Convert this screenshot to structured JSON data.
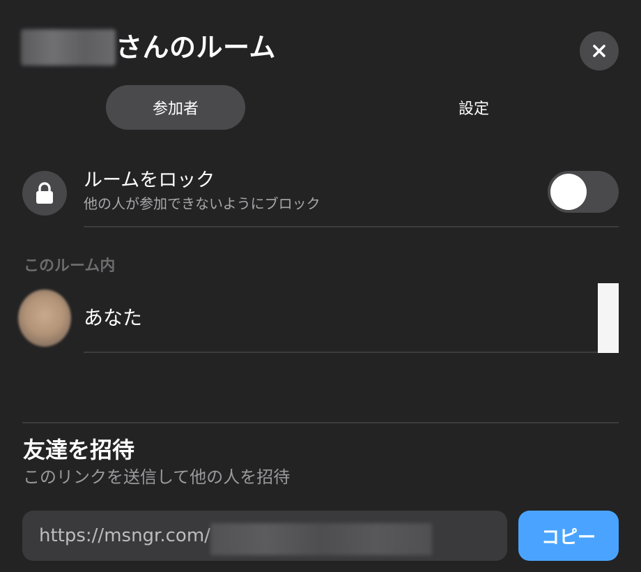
{
  "header": {
    "title": "さんのルーム",
    "close_icon": "close-icon"
  },
  "tabs": [
    {
      "label": "参加者",
      "active": true
    },
    {
      "label": "設定",
      "active": false
    }
  ],
  "lock": {
    "icon": "lock-icon",
    "title": "ルームをロック",
    "subtitle": "他の人が参加できないようにブロック",
    "enabled": false
  },
  "room": {
    "section_label": "このルーム内",
    "participants": [
      {
        "name": "あなた"
      }
    ]
  },
  "invite": {
    "title": "友達を招待",
    "subtitle": "このリンクを送信して他の人を招待",
    "link_prefix": "https://msngr.com/",
    "copy_label": "コピー"
  },
  "colors": {
    "background": "#232324",
    "surface": "#4a4a4c",
    "accent": "#4aa4ff",
    "muted_text": "#a8a8aa"
  }
}
